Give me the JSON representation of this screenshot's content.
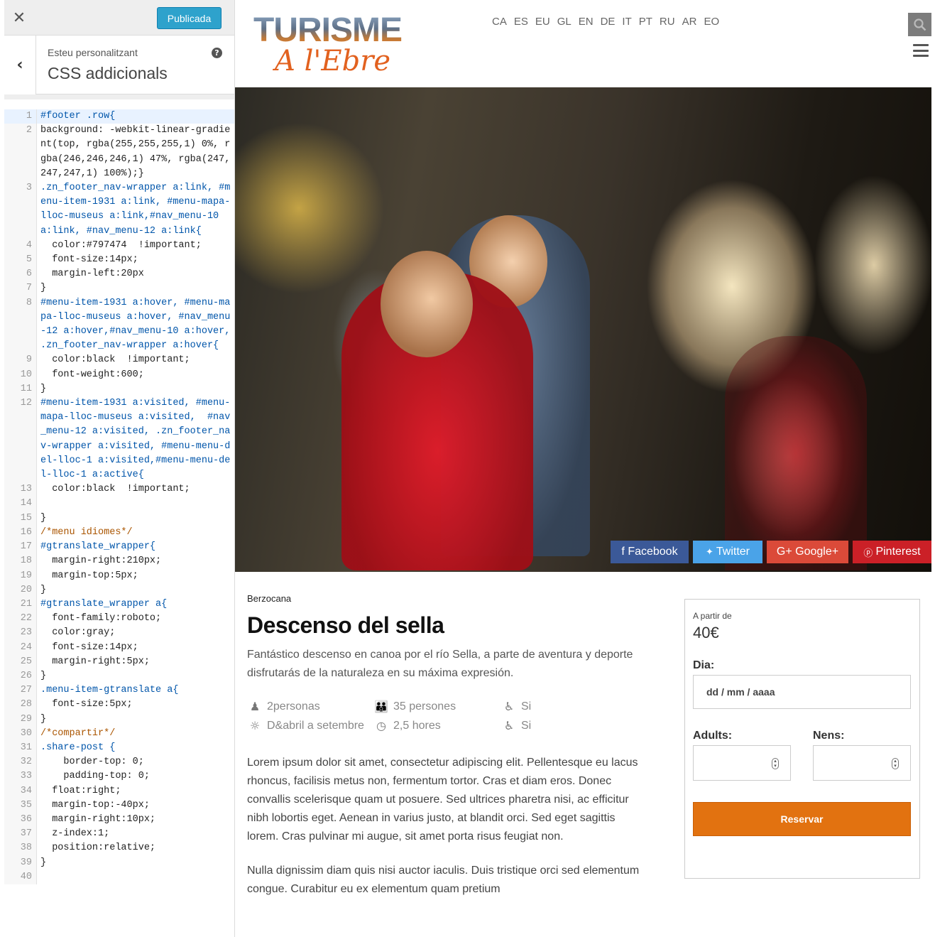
{
  "customizer": {
    "close_icon": "close-icon",
    "publish_label": "Publicada",
    "back_icon": "chevron-left-icon",
    "subtitle": "Esteu personalitzant",
    "title": "CSS addicionals",
    "help_icon": "help-icon",
    "code_lines": [
      {
        "n": "1",
        "t": "#footer .row{"
      },
      {
        "n": "2",
        "t": "background: -webkit-linear-gradient(top, rgba(255,255,255,1) 0%, rgba(246,246,246,1) 47%, rgba(247,247,247,1) 100%);}"
      },
      {
        "n": "3",
        "t": ".zn_footer_nav-wrapper a:link, #menu-item-1931 a:link, #menu-mapa-lloc-museus a:link,#nav_menu-10 a:link, #nav_menu-12 a:link{"
      },
      {
        "n": "4",
        "t": "  color:#797474  !important;"
      },
      {
        "n": "5",
        "t": "  font-size:14px;"
      },
      {
        "n": "6",
        "t": "  margin-left:20px"
      },
      {
        "n": "7",
        "t": "}"
      },
      {
        "n": "8",
        "t": "#menu-item-1931 a:hover, #menu-mapa-lloc-museus a:hover, #nav_menu-12 a:hover,#nav_menu-10 a:hover, .zn_footer_nav-wrapper a:hover{"
      },
      {
        "n": "9",
        "t": "  color:black  !important;"
      },
      {
        "n": "10",
        "t": "  font-weight:600;"
      },
      {
        "n": "11",
        "t": "}"
      },
      {
        "n": "12",
        "t": "#menu-item-1931 a:visited, #menu-mapa-lloc-museus a:visited,  #nav_menu-12 a:visited, .zn_footer_nav-wrapper a:visited, #menu-menu-del-lloc-1 a:visited,#menu-menu-del-lloc-1 a:active{"
      },
      {
        "n": "13",
        "t": "  color:black  !important;"
      },
      {
        "n": "14",
        "t": ""
      },
      {
        "n": "15",
        "t": "}"
      },
      {
        "n": "16",
        "t": "/*menu idiomes*/"
      },
      {
        "n": "17",
        "t": "#gtranslate_wrapper{"
      },
      {
        "n": "18",
        "t": "  margin-right:210px;"
      },
      {
        "n": "19",
        "t": "  margin-top:5px;"
      },
      {
        "n": "20",
        "t": "}"
      },
      {
        "n": "21",
        "t": "#gtranslate_wrapper a{"
      },
      {
        "n": "22",
        "t": "  font-family:roboto;"
      },
      {
        "n": "23",
        "t": "  color:gray;"
      },
      {
        "n": "24",
        "t": "  font-size:14px;"
      },
      {
        "n": "25",
        "t": "  margin-right:5px;"
      },
      {
        "n": "26",
        "t": "}"
      },
      {
        "n": "27",
        "t": ".menu-item-gtranslate a{"
      },
      {
        "n": "28",
        "t": "  font-size:5px;"
      },
      {
        "n": "29",
        "t": "}"
      },
      {
        "n": "30",
        "t": "/*compartir*/"
      },
      {
        "n": "31",
        "t": ".share-post {"
      },
      {
        "n": "32",
        "t": "    border-top: 0;"
      },
      {
        "n": "33",
        "t": "    padding-top: 0;"
      },
      {
        "n": "34",
        "t": "  float:right;"
      },
      {
        "n": "35",
        "t": "  margin-top:-40px;"
      },
      {
        "n": "36",
        "t": "  margin-right:10px;"
      },
      {
        "n": "37",
        "t": "  z-index:1;"
      },
      {
        "n": "38",
        "t": "  position:relative;"
      },
      {
        "n": "39",
        "t": "}"
      },
      {
        "n": "40",
        "t": ""
      }
    ]
  },
  "site": {
    "logo_line1": "TURISME",
    "logo_line2": "A l'Ebre",
    "languages": [
      "CA",
      "ES",
      "EU",
      "GL",
      "EN",
      "DE",
      "IT",
      "PT",
      "RU",
      "AR",
      "EO"
    ],
    "search_icon": "search-icon",
    "menu_icon": "hamburger-menu-icon"
  },
  "share": {
    "facebook": "f Facebook",
    "twitter": "Twitter",
    "google": "G+ Google+",
    "pinterest": "Pinterest",
    "colors": {
      "facebook": "#3b5998",
      "twitter": "#4aa3e8",
      "google": "#db4a39",
      "pinterest": "#cb2027"
    }
  },
  "tour": {
    "location": "Berzocana",
    "title": "Descenso del sella",
    "description": "Fantástico descenso en canoa por el río Sella, a parte de aventura y deporte disfrutarás de la naturaleza en su máxima expresión.",
    "features": [
      {
        "icon": "person-icon",
        "glyph": "♟",
        "text": "2personas"
      },
      {
        "icon": "group-icon",
        "glyph": "👪",
        "text": "35 persones"
      },
      {
        "icon": "wheelchair-accessible-icon",
        "glyph": "♿",
        "text": "Si"
      },
      {
        "icon": "season-icon",
        "glyph": "☼",
        "text": "D&abril a setembre"
      },
      {
        "icon": "clock-icon",
        "glyph": "◷",
        "text": "2,5 hores"
      },
      {
        "icon": "accessibility-icon",
        "glyph": "♿",
        "text": "Si"
      }
    ],
    "paragraph1": "Lorem ipsum dolor sit amet, consectetur adipiscing elit. Pellentesque eu lacus rhoncus, facilisis metus non, fermentum tortor. Cras et diam eros. Donec convallis scelerisque quam ut posuere. Sed ultrices pharetra nisi, ac efficitur nibh lobortis eget. Aenean in varius justo, at blandit orci. Sed eget sagittis lorem. Cras pulvinar mi augue, sit amet porta risus feugiat non.",
    "paragraph2": "Nulla dignissim diam quis nisi auctor iaculis. Duis tristique orci sed elementum congue. Curabitur eu ex elementum quam pretium"
  },
  "booking": {
    "from_label": "A partir de",
    "price": "40€",
    "day_label": "Dia:",
    "date_placeholder": "dd / mm / aaaa",
    "adults_label": "Adults:",
    "kids_label": "Nens:",
    "button_label": "Reservar",
    "accent_color": "#e27210"
  }
}
